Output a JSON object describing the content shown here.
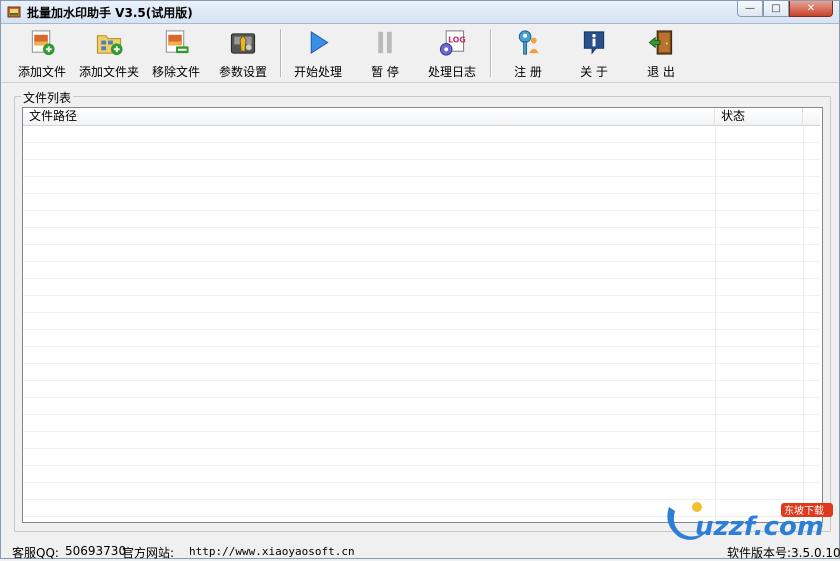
{
  "window": {
    "title": "批量加水印助手 V3.5(试用版)",
    "buttons": {
      "minimize": "—",
      "maximize": "□",
      "close": "✕"
    }
  },
  "toolbar": {
    "items": [
      {
        "label": "添加文件",
        "icon": "add-file-icon"
      },
      {
        "label": "添加文件夹",
        "icon": "add-folder-icon"
      },
      {
        "label": "移除文件",
        "icon": "remove-file-icon"
      },
      {
        "label": "参数设置",
        "icon": "settings-icon"
      },
      {
        "label": "开始处理",
        "icon": "play-icon"
      },
      {
        "label": "暂 停",
        "icon": "pause-icon"
      },
      {
        "label": "处理日志",
        "icon": "log-icon"
      },
      {
        "label": "注 册",
        "icon": "register-key-icon"
      },
      {
        "label": "关 于",
        "icon": "about-info-icon"
      },
      {
        "label": "退 出",
        "icon": "exit-door-icon"
      }
    ]
  },
  "file_list": {
    "group_label": "文件列表",
    "columns": [
      "文件路径",
      "状态"
    ],
    "rows": []
  },
  "statusbar": {
    "qq_label": "客服QQ:",
    "qq_value": "50693730",
    "site_label": "官方网站:",
    "site_url": "http://www.xiaoyaosoft.cn",
    "version": "软件版本号:3.5.0.10"
  },
  "watermark": {
    "text": "uzzf.com",
    "badge": "东坡下载"
  },
  "colors": {
    "accent_blue": "#2c7fd6",
    "watermark_red": "#e03a1e",
    "title_gradient_top": "#e9f1fb"
  }
}
